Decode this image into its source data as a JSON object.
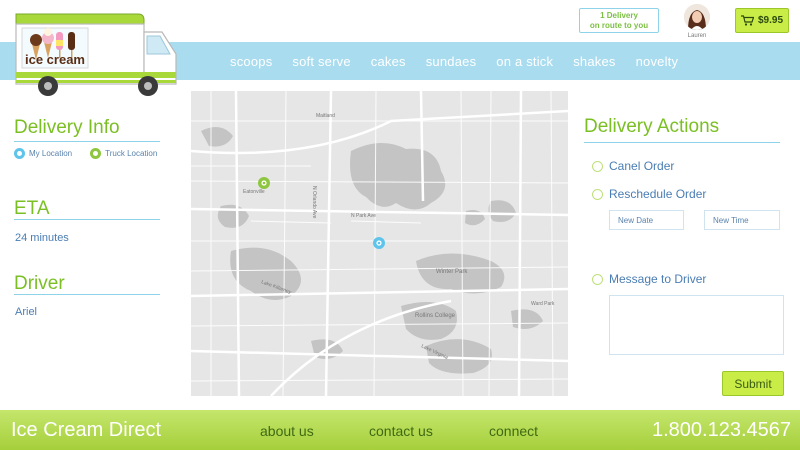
{
  "header": {
    "logo_text": "ice cream",
    "delivery_status": {
      "line1": "1 Delivery",
      "line2": "on route to you"
    },
    "user": {
      "name": "Lauren"
    },
    "cart": {
      "total": "$9.95"
    }
  },
  "nav": {
    "items": [
      "scoops",
      "soft serve",
      "cakes",
      "sundaes",
      "on a stick",
      "shakes",
      "novelty"
    ]
  },
  "delivery_info": {
    "title": "Delivery Info",
    "legend": {
      "my_location": "My Location",
      "truck_location": "Truck Location"
    }
  },
  "eta": {
    "title": "ETA",
    "value": "24 minutes"
  },
  "driver": {
    "title": "Driver",
    "name": "Ariel"
  },
  "map": {
    "labels": [
      "Eatonville",
      "Maitland",
      "Lake Killarney",
      "Winter Park",
      "Rollins College",
      "Lake Virginia",
      "N Park Ave",
      "N Orlando Ave",
      "Ward Park"
    ],
    "markers": {
      "truck": {
        "color": "#8ec63f"
      },
      "me": {
        "color": "#5fc4ec"
      }
    }
  },
  "delivery_actions": {
    "title": "Delivery Actions",
    "cancel_label": "Canel Order",
    "reschedule_label": "Reschedule Order",
    "new_date_placeholder": "New Date",
    "new_time_placeholder": "New Time",
    "message_label": "Message to Driver",
    "message_value": "",
    "submit_label": "Submit"
  },
  "footer": {
    "brand": "Ice Cream Direct",
    "links": [
      "about us",
      "contact us",
      "connect"
    ],
    "phone": "1.800.123.4567"
  },
  "colors": {
    "accent_green": "#7bbf25",
    "nav_blue": "#a9dcef",
    "button_lime": "#c9ec47",
    "text_blue": "#4a7db3"
  }
}
